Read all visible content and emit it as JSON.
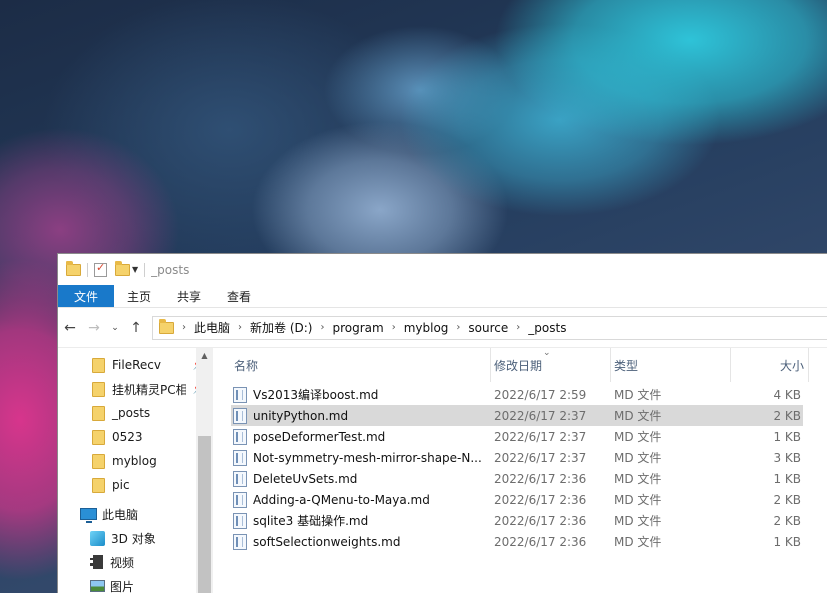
{
  "window": {
    "title": "_posts"
  },
  "ribbon": {
    "tabs": [
      "文件",
      "主页",
      "共享",
      "查看"
    ]
  },
  "address": {
    "crumbs": [
      "此电脑",
      "新加卷 (D:)",
      "program",
      "myblog",
      "source",
      "_posts"
    ]
  },
  "navpane": {
    "quick_access": [
      {
        "label": "FileRecv",
        "pinned": true
      },
      {
        "label": "挂机精灵PC相",
        "pinned": true
      },
      {
        "label": "_posts",
        "pinned": false
      },
      {
        "label": "0523",
        "pinned": false
      },
      {
        "label": "myblog",
        "pinned": false
      },
      {
        "label": "pic",
        "pinned": false
      }
    ],
    "this_pc": "此电脑",
    "pc_items": [
      {
        "label": "3D 对象",
        "icon": "cube-icon"
      },
      {
        "label": "视频",
        "icon": "video-icon"
      },
      {
        "label": "图片",
        "icon": "pictures-icon"
      }
    ]
  },
  "columns": {
    "name": "名称",
    "date": "修改日期",
    "type": "类型",
    "size": "大小"
  },
  "files": [
    {
      "name": "Vs2013编译boost.md",
      "date": "2022/6/17 2:59",
      "type": "MD 文件",
      "size": "4 KB",
      "selected": false
    },
    {
      "name": "unityPython.md",
      "date": "2022/6/17 2:37",
      "type": "MD 文件",
      "size": "2 KB",
      "selected": true
    },
    {
      "name": "poseDeformerTest.md",
      "date": "2022/6/17 2:37",
      "type": "MD 文件",
      "size": "1 KB",
      "selected": false
    },
    {
      "name": "Not-symmetry-mesh-mirror-shape-N...",
      "date": "2022/6/17 2:37",
      "type": "MD 文件",
      "size": "3 KB",
      "selected": false
    },
    {
      "name": "DeleteUvSets.md",
      "date": "2022/6/17 2:36",
      "type": "MD 文件",
      "size": "1 KB",
      "selected": false
    },
    {
      "name": "Adding-a-QMenu-to-Maya.md",
      "date": "2022/6/17 2:36",
      "type": "MD 文件",
      "size": "2 KB",
      "selected": false
    },
    {
      "name": "sqlite3 基础操作.md",
      "date": "2022/6/17 2:36",
      "type": "MD 文件",
      "size": "2 KB",
      "selected": false
    },
    {
      "name": "softSelectionweights.md",
      "date": "2022/6/17 2:36",
      "type": "MD 文件",
      "size": "1 KB",
      "selected": false
    }
  ],
  "colors": {
    "file_tab": "#1979ca",
    "selection": "#d9d9d9",
    "folder": "#f5d26b"
  }
}
